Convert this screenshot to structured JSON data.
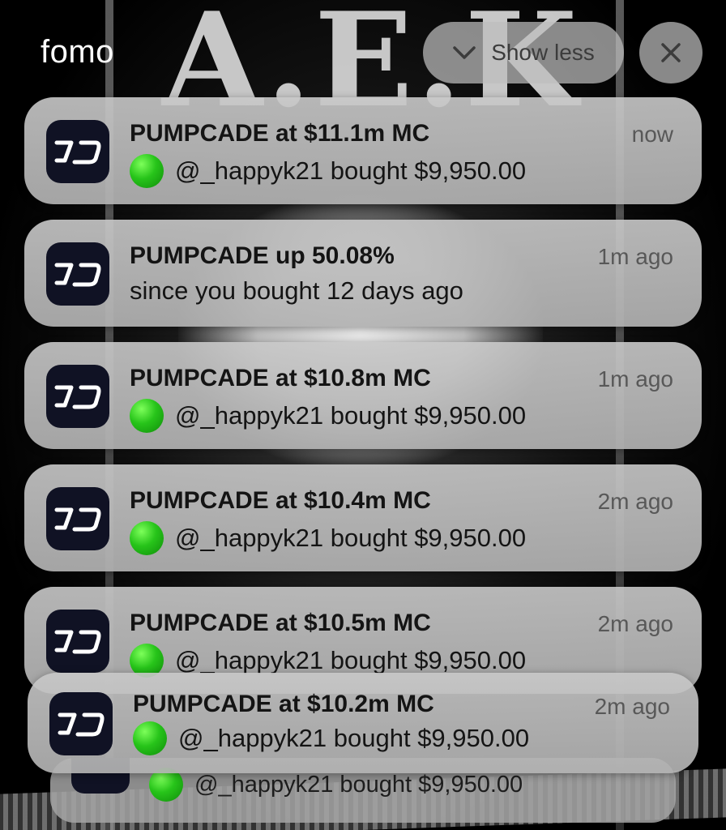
{
  "wallpaper_text": "A.E.K",
  "app_title": "fomo",
  "controls": {
    "show_less_label": "Show less",
    "show_less_icon": "chevron-down-icon",
    "close_icon": "close-icon"
  },
  "notifications": [
    {
      "title": "PUMPCADE at $11.1m MC",
      "body": "@_happyk21 bought $9,950.00",
      "time": "now",
      "badge": "green-circle"
    },
    {
      "title": "PUMPCADE up 50.08%",
      "body": "since you bought 12 days ago",
      "time": "1m ago"
    },
    {
      "title": "PUMPCADE at $10.8m MC",
      "body": "@_happyk21 bought $9,950.00",
      "time": "1m ago",
      "badge": "green-circle"
    },
    {
      "title": "PUMPCADE at $10.4m MC",
      "body": "@_happyk21 bought $9,950.00",
      "time": "2m ago",
      "badge": "green-circle"
    },
    {
      "title": "PUMPCADE at $10.5m MC",
      "body": "@_happyk21 bought $9,950.00",
      "time": "2m ago",
      "badge": "green-circle"
    },
    {
      "title": "PUMPCADE at $10.2m MC",
      "body": "@_happyk21 bought $9,950.00",
      "time": "2m ago",
      "badge": "green-circle"
    }
  ],
  "stacked_peek": {
    "body": "@_happyk21 bought $9,950.00"
  },
  "colors": {
    "app_icon_bg": "#101224",
    "badge_green": "#27c41a"
  }
}
